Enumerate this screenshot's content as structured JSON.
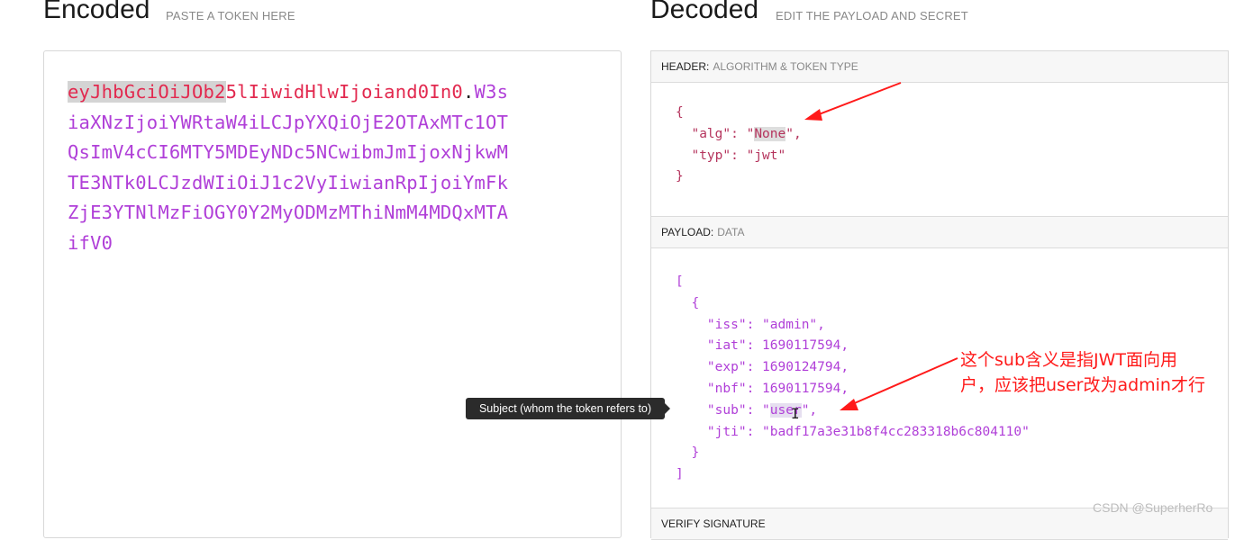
{
  "encoded": {
    "title": "Encoded",
    "subtitle": "PASTE A TOKEN HERE",
    "token_header_selected": "eyJhbGciOiJOb2",
    "token_header_rest": "5lIiwidHlwIjoiand0In0",
    "token_dot": ".",
    "token_payload_lines": [
      "W3s",
      "iaXNzIjoiYWRtaW4iLCJpYXQiOjE2OTAxMTc1OT",
      "QsImV4cCI6MTY5MDEyNDc5NCwibmJmIjoxNjkwM",
      "TE3NTk0LCJzdWIiOiJ1c2VyIiwianRpIjoiYmFk",
      "ZjE3YTNlMzFiOGY0Y2MyODMzMThiNmM4MDQxMTA",
      "ifV0"
    ]
  },
  "decoded": {
    "title": "Decoded",
    "subtitle": "EDIT THE PAYLOAD AND SECRET",
    "header_section": {
      "key": "HEADER:",
      "value": "ALGORITHM & TOKEN TYPE"
    },
    "header_json": {
      "open": "{",
      "alg_key": "\"alg\"",
      "alg_open_quote": "\"",
      "alg_value": "None",
      "alg_close": "\",",
      "typ_key": "\"typ\"",
      "typ_value": "\"jwt\"",
      "close": "}"
    },
    "payload_section": {
      "key": "PAYLOAD:",
      "value": "DATA"
    },
    "payload_json": {
      "open_bracket": "[",
      "open_brace": "{",
      "iss_key": "\"iss\"",
      "iss_value": "\"admin\",",
      "iat_key": "\"iat\"",
      "iat_value": "1690117594,",
      "exp_key": "\"exp\"",
      "exp_value": "1690124794,",
      "nbf_key": "\"nbf\"",
      "nbf_value": "1690117594,",
      "sub_key": "\"sub\"",
      "sub_open_quote": "\"",
      "sub_value": "user",
      "sub_close": "\",",
      "jti_key": "\"jti\"",
      "jti_value": "\"badf17a3e31b8f4cc283318b6c804110\"",
      "close_brace": "}",
      "close_bracket": "]"
    },
    "verify_section": {
      "key": "VERIFY SIGNATURE"
    }
  },
  "tooltip": "Subject (whom the token refers to)",
  "annotation_lines": [
    "这个sub含义是指JWT面向用",
    "户，应该把user改为admin才行"
  ],
  "watermark": "CSDN @SuperherRo",
  "colors": {
    "header_part": "#e2294f",
    "payload_part": "#b03fd8",
    "annotation": "#ff1a1a"
  }
}
